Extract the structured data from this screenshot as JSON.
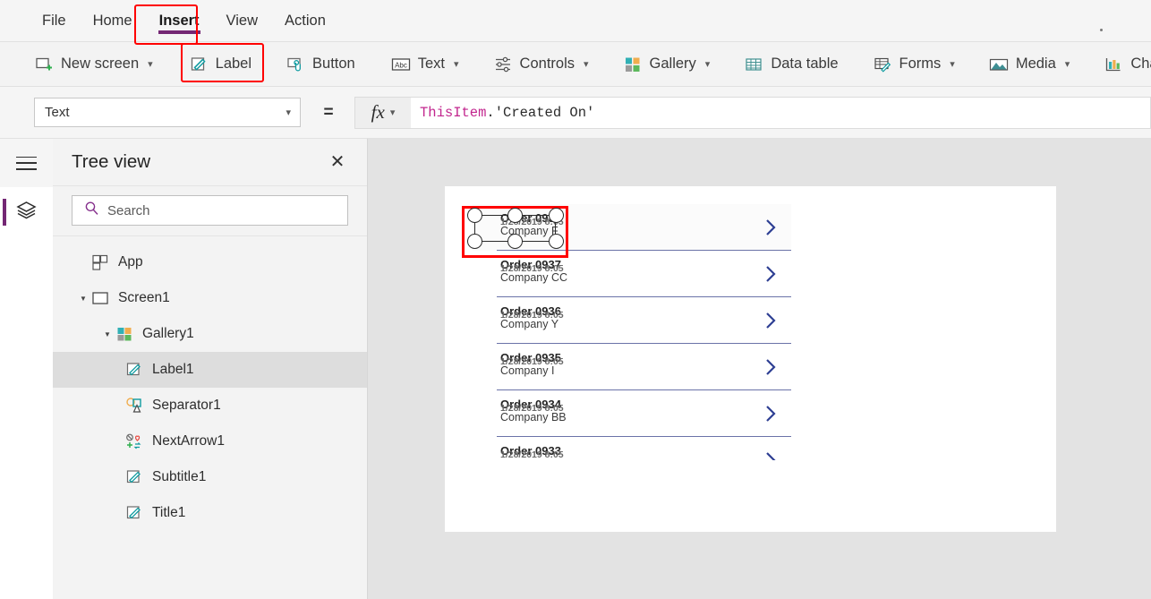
{
  "menu": {
    "items": [
      {
        "label": "File",
        "active": false
      },
      {
        "label": "Home",
        "active": false
      },
      {
        "label": "Insert",
        "active": true
      },
      {
        "label": "View",
        "active": false
      },
      {
        "label": "Action",
        "active": false
      }
    ]
  },
  "ribbon": {
    "buttons": [
      {
        "label": "New screen",
        "icon": "new-screen-icon",
        "caret": true
      },
      {
        "label": "Label",
        "icon": "label-icon",
        "caret": false
      },
      {
        "label": "Button",
        "icon": "button-icon",
        "caret": false
      },
      {
        "label": "Text",
        "icon": "text-abc-icon",
        "caret": true
      },
      {
        "label": "Controls",
        "icon": "controls-sliders-icon",
        "caret": true
      },
      {
        "label": "Gallery",
        "icon": "gallery-grid-icon",
        "caret": true
      },
      {
        "label": "Data table",
        "icon": "data-table-icon",
        "caret": false
      },
      {
        "label": "Forms",
        "icon": "forms-icon",
        "caret": true
      },
      {
        "label": "Media",
        "icon": "media-image-icon",
        "caret": true
      },
      {
        "label": "Char",
        "icon": "charts-bar-icon",
        "caret": false
      }
    ]
  },
  "formula_bar": {
    "property": "Text",
    "equals": "=",
    "fx_label": "fx",
    "formula_token_1": "ThisItem",
    "formula_token_2": ".'Created On'"
  },
  "tree_view": {
    "title": "Tree view",
    "close_icon": "✕",
    "search_placeholder": "Search",
    "nodes": [
      {
        "label": "App",
        "icon": "app-icon",
        "indent": 1,
        "twisty": "",
        "selected": false
      },
      {
        "label": "Screen1",
        "icon": "screen-icon",
        "indent": 1,
        "twisty": "▼",
        "selected": false
      },
      {
        "label": "Gallery1",
        "icon": "gallery-grid-icon",
        "indent": 2,
        "twisty": "▼",
        "selected": false
      },
      {
        "label": "Label1",
        "icon": "label-icon",
        "indent": 3,
        "twisty": "",
        "selected": true
      },
      {
        "label": "Separator1",
        "icon": "shapes-icon",
        "indent": 3,
        "twisty": "",
        "selected": false
      },
      {
        "label": "NextArrow1",
        "icon": "icons-icon",
        "indent": 3,
        "twisty": "",
        "selected": false
      },
      {
        "label": "Subtitle1",
        "icon": "label-icon",
        "indent": 3,
        "twisty": "",
        "selected": false
      },
      {
        "label": "Title1",
        "icon": "label-icon",
        "indent": 3,
        "twisty": "",
        "selected": false
      }
    ]
  },
  "canvas": {
    "gallery": {
      "items": [
        {
          "title": "Order 0938",
          "date": "1/28/2019 8:05",
          "subtitle": "Company F",
          "selected": true
        },
        {
          "title": "Order 0937",
          "date": "1/28/2019 8:05",
          "subtitle": "Company CC",
          "selected": false
        },
        {
          "title": "Order 0936",
          "date": "1/28/2019 8:05",
          "subtitle": "Company Y",
          "selected": false
        },
        {
          "title": "Order 0935",
          "date": "1/28/2019 8:05",
          "subtitle": "Company I",
          "selected": false
        },
        {
          "title": "Order 0934",
          "date": "1/28/2019 8:05",
          "subtitle": "Company BB",
          "selected": false
        },
        {
          "title": "Order 0933",
          "date": "1/28/2019 8:05",
          "subtitle": "",
          "selected": false
        }
      ],
      "chevron_icon": "chevron-right-icon"
    }
  },
  "rail": {
    "menu_icon": "hamburger-icon",
    "items": [
      {
        "icon": "layers-icon",
        "active": true
      }
    ]
  },
  "colors": {
    "accent_purple": "#742774",
    "highlight_red": "#ff0000",
    "chevron_blue": "#2e3f93",
    "separator_blue": "#6b73a8"
  }
}
